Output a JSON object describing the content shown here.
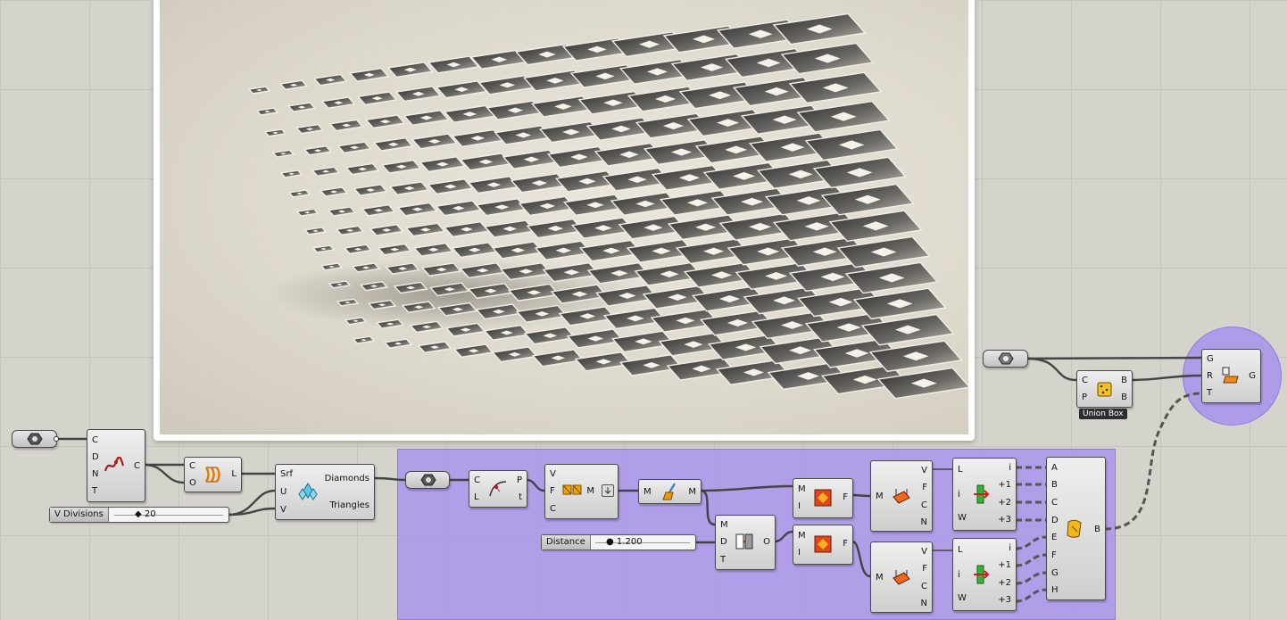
{
  "canvas": {
    "grid_color": "#c6c6be",
    "background_color": "#d4d4cc",
    "group_color": "#ab96ec"
  },
  "preview": {
    "icon": "rendered-diamond-lattice-image"
  },
  "nodes": {
    "curve_param": {
      "icon": "hexagon-param-icon"
    },
    "ctrl_curve": {
      "inputs": [
        "C",
        "D",
        "N",
        "T"
      ],
      "outputs": [
        "C"
      ],
      "icon": "control-point-curve-icon"
    },
    "loft": {
      "inputs": [
        "C",
        "O"
      ],
      "outputs": [
        "L"
      ],
      "icon": "loft-icon"
    },
    "diamond_panels": {
      "inputs": [
        "Srf",
        "U",
        "V"
      ],
      "outputs": [
        "Diamonds",
        "Triangles"
      ],
      "icon": "diamond-panels-icon"
    },
    "geometry_param": {
      "icon": "hexagon-param-icon"
    },
    "curve_closest": {
      "inputs": [
        "C",
        "L"
      ],
      "outputs": [
        "P",
        "t"
      ],
      "icon": "curve-point-icon"
    },
    "mesh_from_poly": {
      "inputs": [
        "V",
        "F",
        "C"
      ],
      "outputs": [
        "M"
      ],
      "icon": "mesh-construct-icon"
    },
    "mesh_clean": {
      "inputs": [
        "M"
      ],
      "outputs": [
        "M"
      ],
      "icon": "brush-clean-icon"
    },
    "offset_mesh": {
      "inputs": [
        "M",
        "D",
        "T"
      ],
      "outputs": [
        "O"
      ],
      "icon": "offset-mesh-icon"
    },
    "flip_top": {
      "inputs": [
        "M",
        "I"
      ],
      "outputs": [
        "F"
      ],
      "icon": "flip-faces-icon"
    },
    "flip_bottom": {
      "inputs": [
        "M",
        "I"
      ],
      "outputs": [
        "F"
      ],
      "icon": "flip-faces-icon"
    },
    "deconstruct_top": {
      "inputs": [
        "M"
      ],
      "outputs": [
        "V",
        "F",
        "C",
        "N"
      ],
      "icon": "deconstruct-mesh-icon"
    },
    "deconstruct_bottom": {
      "inputs": [
        "M"
      ],
      "outputs": [
        "V",
        "F",
        "C",
        "N"
      ],
      "icon": "deconstruct-mesh-icon"
    },
    "list_item_top": {
      "inputs": [
        "L",
        "i",
        "W"
      ],
      "outputs": [
        "i",
        "+1",
        "+2",
        "+3"
      ],
      "icon": "list-item-icon"
    },
    "list_item_bottom": {
      "inputs": [
        "L",
        "i",
        "W"
      ],
      "outputs": [
        "i",
        "+1",
        "+2",
        "+3"
      ],
      "icon": "list-item-icon"
    },
    "brep_join": {
      "inputs": [
        "A",
        "B",
        "C",
        "D",
        "E",
        "F",
        "G",
        "H"
      ],
      "outputs": [
        "B"
      ],
      "icon": "brep-join-icon"
    },
    "geometry_param_right": {
      "icon": "hexagon-param-icon"
    },
    "union_box": {
      "inputs": [
        "C",
        "P"
      ],
      "outputs": [
        "B",
        "B"
      ],
      "caption": "Union Box",
      "icon": "box-dice-icon"
    },
    "transform": {
      "inputs": [
        "G",
        "R",
        "T"
      ],
      "outputs": [
        "G"
      ],
      "icon": "orient-transform-icon"
    }
  },
  "sliders": {
    "v_divisions": {
      "label": "V Divisions",
      "value": "20"
    },
    "distance": {
      "label": "Distance",
      "value": "1.200"
    }
  }
}
